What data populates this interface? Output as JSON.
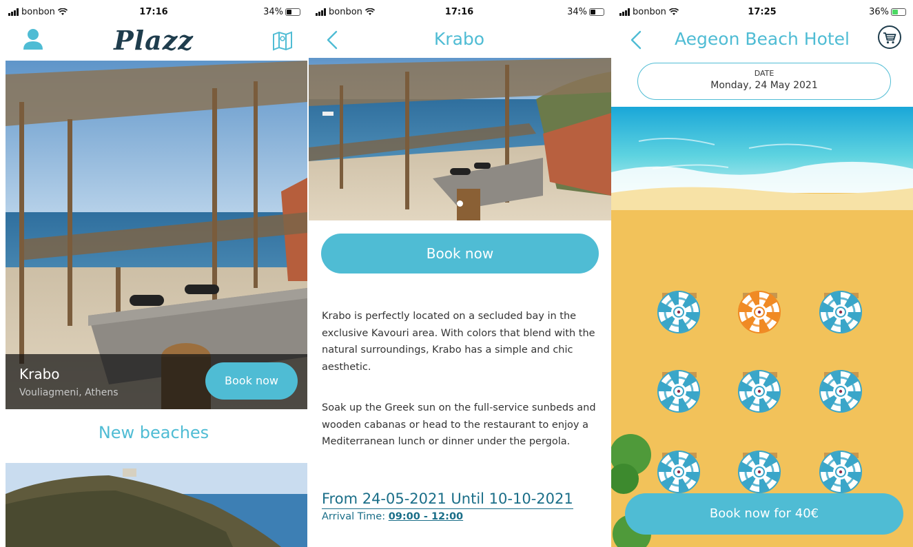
{
  "colors": {
    "accent": "#4fbcd4",
    "dark_teal": "#1a6e88",
    "logo": "#1f3d4d"
  },
  "screen1": {
    "status": {
      "carrier": "bonbon",
      "time": "17:16",
      "battery": "34%"
    },
    "logo": "Plazz",
    "left_icon": "profile-icon",
    "right_icon": "map-icon",
    "featured": {
      "name": "Krabo",
      "location": "Vouliagmeni, Athens",
      "book_label": "Book now"
    },
    "section_title": "New beaches"
  },
  "screen2": {
    "status": {
      "carrier": "bonbon",
      "time": "17:16",
      "battery": "34%"
    },
    "title": "Krabo",
    "book_label": "Book now",
    "description_1": "Krabo is perfectly located on a secluded bay in the exclusive Kavouri area. With colors that blend with the natural surroundings, Krabo has a simple and chic aesthetic.",
    "description_2": "Soak up the Greek sun on the full-service sunbeds and wooden cabanas or head to the restaurant to enjoy a Mediterranean lunch or dinner under the pergola.",
    "period": "From 24-05-2021 Until 10-10-2021",
    "arrival_label": "Arrival Time:",
    "arrival_value": "09:00 - 12:00"
  },
  "screen3": {
    "status": {
      "carrier": "bonbon",
      "time": "17:25",
      "battery": "36%"
    },
    "title": "Aegeon Beach Hotel",
    "right_icon": "cart-icon",
    "date_label": "DATE",
    "date_value": "Monday, 24 May 2021",
    "umbrellas": [
      {
        "state": "available",
        "color": "#3aa6c9"
      },
      {
        "state": "selected",
        "color": "#f08a24"
      },
      {
        "state": "available",
        "color": "#3aa6c9"
      },
      {
        "state": "available",
        "color": "#3aa6c9"
      },
      {
        "state": "available",
        "color": "#3aa6c9"
      },
      {
        "state": "available",
        "color": "#3aa6c9"
      },
      {
        "state": "available",
        "color": "#3aa6c9"
      },
      {
        "state": "available",
        "color": "#3aa6c9"
      },
      {
        "state": "available",
        "color": "#3aa6c9"
      }
    ],
    "book_label": "Book now for 40€"
  }
}
